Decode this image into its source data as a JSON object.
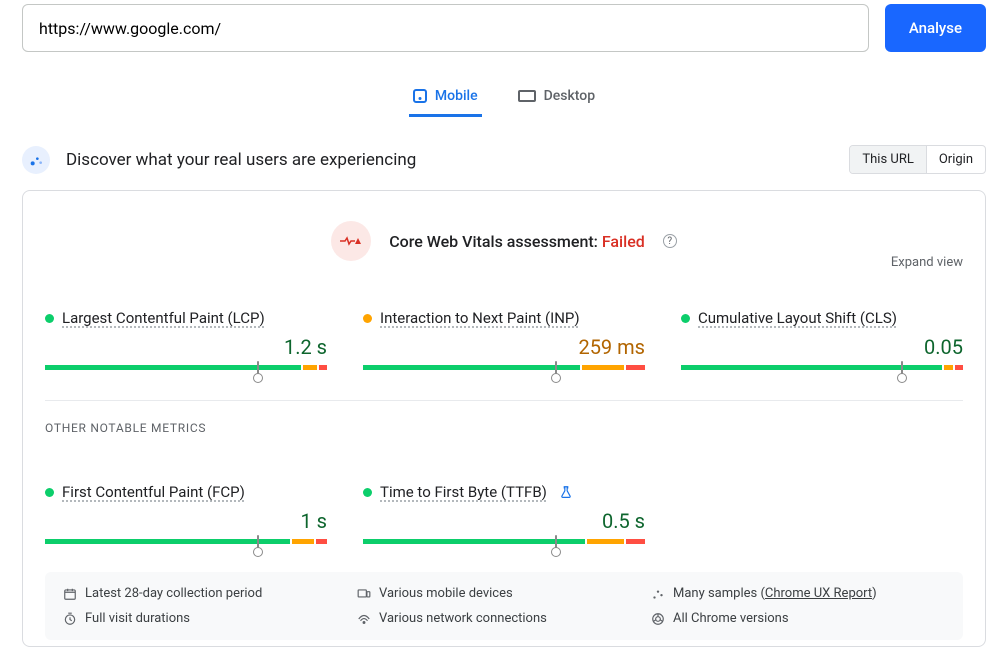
{
  "url": "https://www.google.com/",
  "analyse_label": "Analyse",
  "tabs": {
    "mobile": "Mobile",
    "desktop": "Desktop"
  },
  "discover": {
    "title": "Discover what your real users are experiencing",
    "this_url": "This URL",
    "origin": "Origin"
  },
  "assessment": {
    "title": "Core Web Vitals assessment:",
    "status": "Failed"
  },
  "expand_label": "Expand view",
  "metrics": {
    "lcp": {
      "name": "Largest Contentful Paint (LCP)",
      "value": "1.2 s"
    },
    "inp": {
      "name": "Interaction to Next Paint (INP)",
      "value": "259 ms"
    },
    "cls": {
      "name": "Cumulative Layout Shift (CLS)",
      "value": "0.05"
    },
    "fcp": {
      "name": "First Contentful Paint (FCP)",
      "value": "1 s"
    },
    "ttfb": {
      "name": "Time to First Byte (TTFB)",
      "value": "0.5 s"
    }
  },
  "other_label": "OTHER NOTABLE METRICS",
  "footer": {
    "period": "Latest 28-day collection period",
    "devices": "Various mobile devices",
    "samples_prefix": "Many samples (",
    "samples_link": "Chrome UX Report",
    "samples_suffix": ")",
    "durations": "Full visit durations",
    "connections": "Various network connections",
    "versions": "All Chrome versions"
  },
  "chart_data": [
    {
      "metric": "LCP",
      "tick_percent": 75,
      "segments": [
        92,
        5,
        3
      ],
      "status": "good",
      "value": "1.2 s"
    },
    {
      "metric": "INP",
      "tick_percent": 68,
      "segments": [
        78,
        15,
        7
      ],
      "status": "mid",
      "value": "259 ms"
    },
    {
      "metric": "CLS",
      "tick_percent": 78,
      "segments": [
        94,
        3,
        3
      ],
      "status": "good",
      "value": "0.05"
    },
    {
      "metric": "FCP",
      "tick_percent": 75,
      "segments": [
        88,
        8,
        4
      ],
      "status": "good",
      "value": "1 s"
    },
    {
      "metric": "TTFB",
      "tick_percent": 68,
      "segments": [
        80,
        13,
        7
      ],
      "status": "good",
      "value": "0.5 s"
    }
  ]
}
